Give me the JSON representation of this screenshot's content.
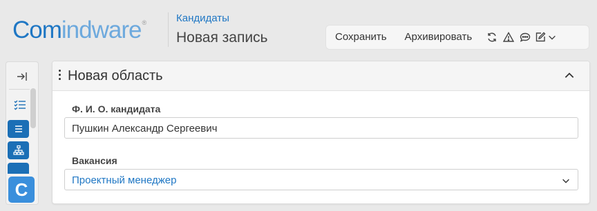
{
  "logo": {
    "part1": "Com",
    "part2": "indware",
    "registered": "®"
  },
  "header": {
    "breadcrumb": "Кандидаты",
    "title": "Новая запись"
  },
  "toolbar": {
    "save_label": "Сохранить",
    "archive_label": "Архивировать",
    "icons": [
      "refresh-icon",
      "warning-icon",
      "comment-icon",
      "edit-icon",
      "chevron-down-icon"
    ]
  },
  "sidebar": {
    "icons": [
      "collapse-sidebar-icon",
      "checklist-icon",
      "list-icon",
      "hierarchy-icon",
      "more-icon"
    ],
    "app_letter": "C"
  },
  "area": {
    "title": "Новая область",
    "fields": [
      {
        "label": "Ф. И. О. кандидата",
        "value": "Пушкин Александр Сергеевич"
      },
      {
        "label": "Вакансия",
        "value": "Проектный менеджер"
      }
    ]
  },
  "colors": {
    "brand": "#1f77c4",
    "brand_light": "#6da9dd",
    "sidebar_button": "#1b6fb6",
    "app_tile": "#3a8fdc"
  }
}
